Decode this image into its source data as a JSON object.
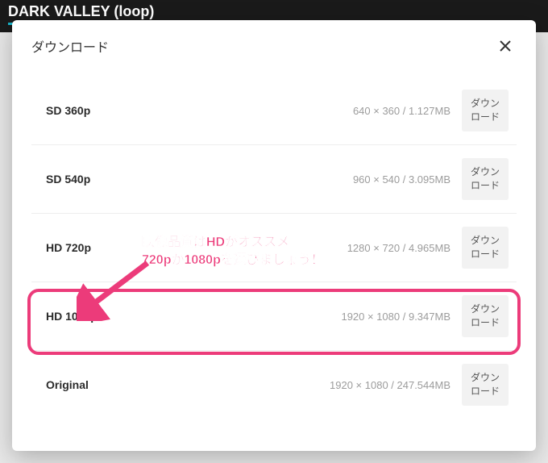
{
  "background": {
    "title": "DARK VALLEY (loop)"
  },
  "modal": {
    "title": "ダウンロード",
    "options": [
      {
        "quality": "SD 360p",
        "spec": "640 × 360 / 1.127MB",
        "button": "ダウン\nロード"
      },
      {
        "quality": "SD 540p",
        "spec": "960 × 540 / 3.095MB",
        "button": "ダウン\nロード"
      },
      {
        "quality": "HD 720p",
        "spec": "1280 × 720 / 4.965MB",
        "button": "ダウン\nロード"
      },
      {
        "quality": "HD 1080p",
        "spec": "1920 × 1080 / 9.347MB",
        "button": "ダウン\nロード"
      },
      {
        "quality": "Original",
        "spec": "1920 × 1080 / 247.544MB",
        "button": "ダウン\nロード"
      }
    ]
  },
  "annotation": {
    "text": "映像品質はHDがオススメ\n720pか1080pを選びましょう！"
  }
}
